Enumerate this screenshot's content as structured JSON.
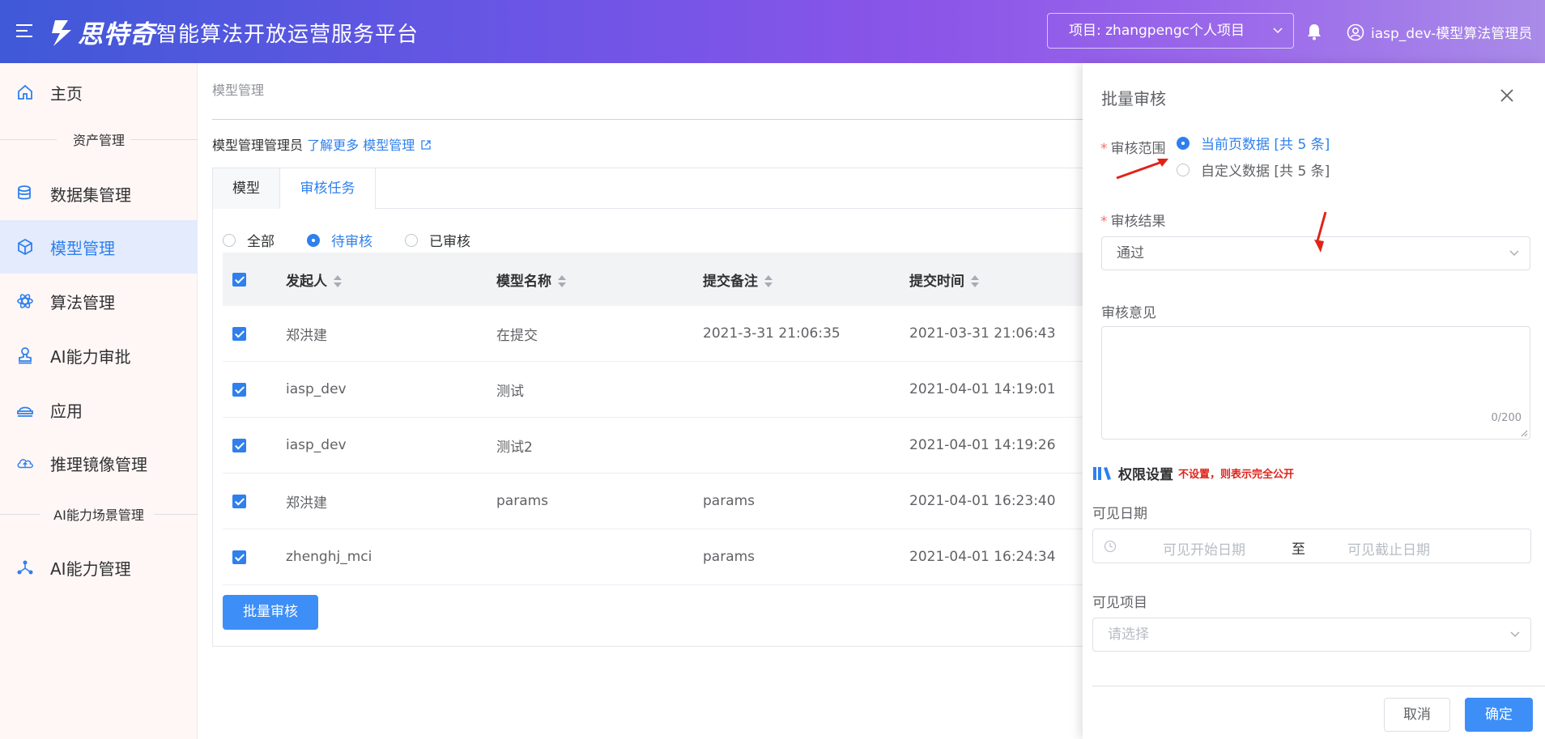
{
  "header": {
    "logo_text": "思特奇",
    "platform_title": "智能算法开放运营服务平台",
    "project_label": "项目: zhangpengc个人项目",
    "user_name": "iasp_dev-模型算法管理员"
  },
  "sidebar": {
    "items": [
      {
        "label": "主页",
        "icon": "home-icon"
      },
      {
        "label": "数据集管理",
        "icon": "database-icon"
      },
      {
        "label": "模型管理",
        "icon": "cube-icon"
      },
      {
        "label": "算法管理",
        "icon": "atom-icon"
      },
      {
        "label": "AI能力审批",
        "icon": "stamp-icon"
      },
      {
        "label": "应用",
        "icon": "app-icon"
      },
      {
        "label": "推理镜像管理",
        "icon": "cloud-icon"
      },
      {
        "label": "AI能力管理",
        "icon": "nodes-icon"
      }
    ],
    "groups": [
      "资产管理",
      "AI能力场景管理"
    ]
  },
  "main": {
    "breadcrumb": "模型管理",
    "intro_text": "模型管理管理员",
    "intro_link": "了解更多 模型管理",
    "tabs": [
      "模型",
      "审核任务"
    ],
    "filter": [
      "全部",
      "待审核",
      "已审核"
    ],
    "columns": [
      "发起人",
      "模型名称",
      "提交备注",
      "提交时间"
    ],
    "rows": [
      {
        "initiator": "郑洪建",
        "model": "在提交",
        "note": "2021-3-31 21:06:35",
        "time": "2021-03-31 21:06:43"
      },
      {
        "initiator": "iasp_dev",
        "model": "测试",
        "note": "",
        "time": "2021-04-01 14:19:01"
      },
      {
        "initiator": "iasp_dev",
        "model": "测试2",
        "note": "",
        "time": "2021-04-01 14:19:26"
      },
      {
        "initiator": "郑洪建",
        "model": "params",
        "note": "params",
        "time": "2021-04-01 16:23:40"
      },
      {
        "initiator": "zhenghj_mci",
        "model": "",
        "note": "params",
        "time": "2021-04-01 16:24:34"
      }
    ],
    "batch_button": "批量审核"
  },
  "drawer": {
    "title": "批量审核",
    "scope_label": "审核范围",
    "scope_options": [
      "当前页数据 [共 5 条]",
      "自定义数据 [共 5 条]"
    ],
    "result_label": "审核结果",
    "result_value": "通过",
    "opinion_label": "审核意见",
    "opinion_count": "0/200",
    "perm_title": "权限设置",
    "perm_note": "不设置，则表示完全公开",
    "date_label": "可见日期",
    "date_start": "可见开始日期",
    "date_sep": "至",
    "date_end": "可见截止日期",
    "project_label": "可见项目",
    "project_placeholder": "请选择",
    "cancel": "取消",
    "confirm": "确定"
  },
  "colors": {
    "primary": "#2f80ed",
    "button": "#3d8ef7",
    "required": "#f56c6c",
    "annotation_arrow": "#e0231a"
  }
}
